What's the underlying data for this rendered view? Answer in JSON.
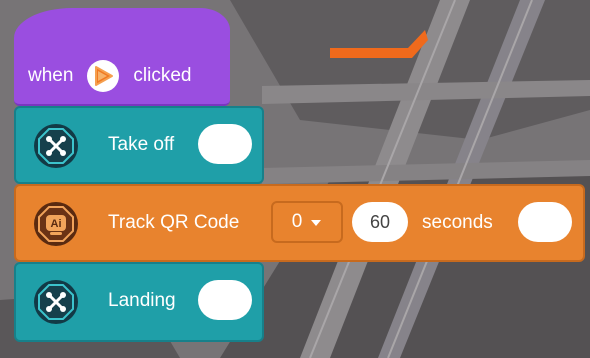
{
  "hat_block": {
    "prefix": "when",
    "suffix": "clicked",
    "icon": "play-flag-icon"
  },
  "blocks": [
    {
      "label": "Take off",
      "icon": "drone-icon",
      "color": "#1f9fa8"
    },
    {
      "label": "Track QR Code",
      "icon": "ai-icon",
      "color": "#e8832e",
      "dropdown_value": "0",
      "duration_value": "60",
      "unit": "seconds"
    },
    {
      "label": "Landing",
      "icon": "drone-icon",
      "color": "#1f9fa8"
    }
  ],
  "colors": {
    "events": "#9a4ee0",
    "drone": "#1f9fa8",
    "ai": "#e8832e",
    "accent_stripe": "#f06a1c"
  }
}
